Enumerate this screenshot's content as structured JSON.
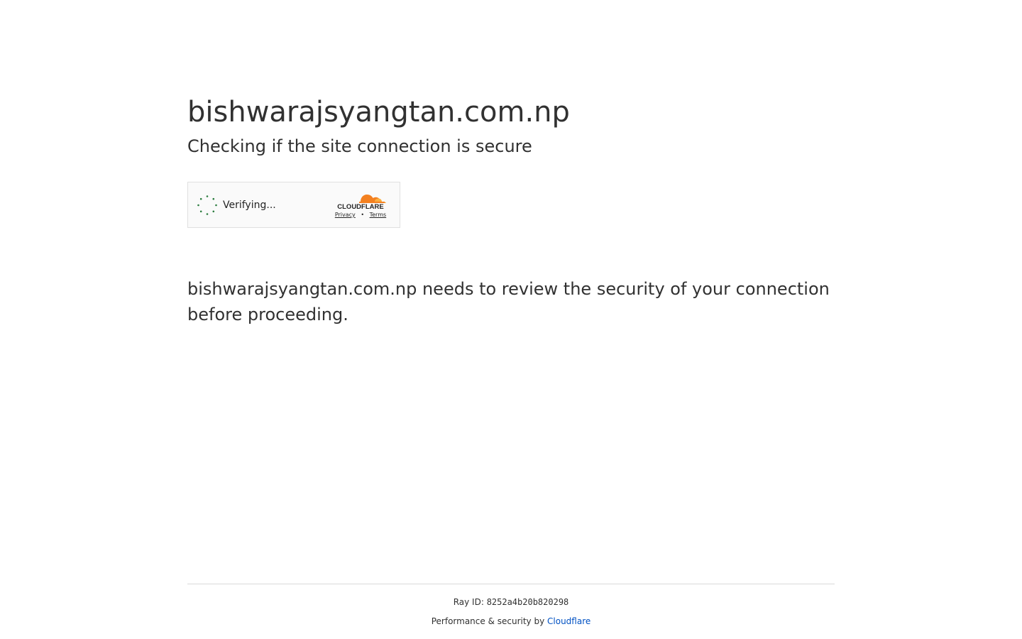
{
  "header": {
    "site_name": "bishwarajsyangtan.com.np",
    "subtitle": "Checking if the site connection is secure"
  },
  "widget": {
    "status": "Verifying...",
    "brand": "CLOUDFLARE",
    "privacy_link": "Privacy",
    "separator": "•",
    "terms_link": "Terms",
    "spinner_color": "#2c7d3f",
    "brand_orange": "#f38020",
    "brand_light_orange": "#faae40"
  },
  "body": {
    "review_message": "bishwarajsyangtan.com.np needs to review the security of your connection before proceeding."
  },
  "footer": {
    "ray_label": "Ray ID: ",
    "ray_id": "8252a4b20b820298",
    "perf_text": "Performance & security by ",
    "perf_link": "Cloudflare",
    "link_color": "#0051c3"
  }
}
